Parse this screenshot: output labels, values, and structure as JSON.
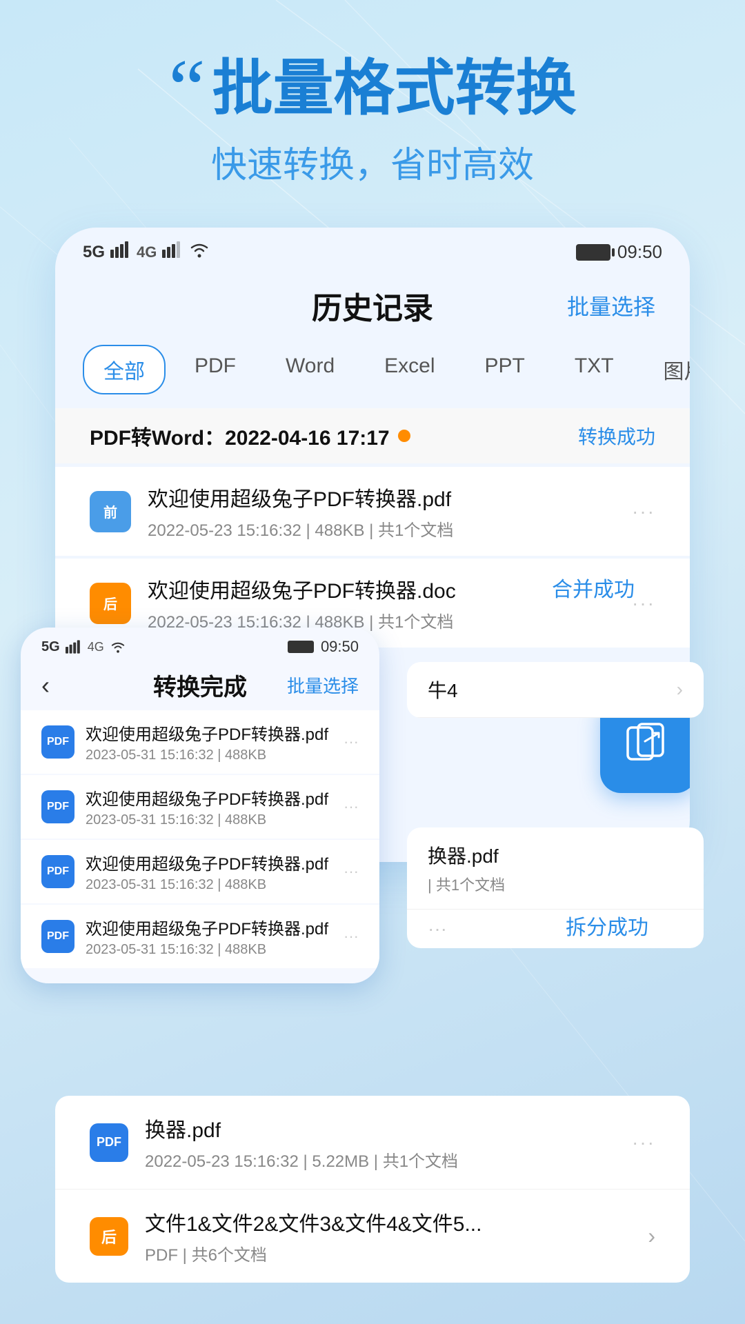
{
  "background": {
    "color_top": "#c5e4f5",
    "color_bottom": "#b0d0ec"
  },
  "header": {
    "quote_mark": "“",
    "title": "批量格式转换",
    "subtitle": "快速转换，省时高效"
  },
  "main_phone": {
    "status_bar": {
      "signal": "5G",
      "signal2": "4G",
      "wifi": "WiFi",
      "battery": "■",
      "time": "09:50"
    },
    "title": "历史记录",
    "batch_btn": "批量选择",
    "tabs": [
      {
        "label": "全部",
        "active": true
      },
      {
        "label": "PDF"
      },
      {
        "label": "Word"
      },
      {
        "label": "Excel"
      },
      {
        "label": "PPT"
      },
      {
        "label": "TXT"
      },
      {
        "label": "图片"
      }
    ],
    "section": {
      "title": "PDF转Word：2022-04-16  17:17",
      "has_dot": true,
      "status": "转换成功"
    },
    "files": [
      {
        "badge_text": "前",
        "badge_type": "qian",
        "name": "欢迎使用超级兔子PDF转换器.pdf",
        "meta": "2022-05-23  15:16:32  |  488KB  |  共1个文档"
      },
      {
        "badge_text": "后",
        "badge_type": "hou",
        "name": "欢迎使用超级兔子PDF转换器.doc",
        "meta": "2022-05-23  15:16:32  |  488KB  |  共1个文档"
      }
    ]
  },
  "secondary_phone": {
    "status_bar": {
      "time": "09:50"
    },
    "title": "转换完成",
    "batch_btn": "批量选择",
    "files": [
      {
        "name": "欢迎使用超级兔子PDF转换器.pdf",
        "meta": "2023-05-31  15:16:32  |  488KB"
      },
      {
        "name": "欢迎使用超级兔子PDF转换器.pdf",
        "meta": "2023-05-31  15:16:32  |  488KB"
      },
      {
        "name": "欢迎使用超级兔子PDF转换器.pdf",
        "meta": "2023-05-31  15:16:32  |  488KB"
      },
      {
        "name": "欢迎使用超级兔子PDF转换器.pdf",
        "meta": "2023-05-31  15:16:32  |  488KB"
      }
    ]
  },
  "merge_success": "合并成功",
  "split_success": "拆分成功",
  "merge_card": {
    "item": {
      "partial_text": "牛4",
      "has_chevron": true
    }
  },
  "split_card": {
    "item1": {
      "name": "换器.pdf",
      "meta": "  |  共1个文档"
    }
  },
  "bottom_section": {
    "file1": {
      "name": "换器.pdf",
      "meta": "2022-05-23  15:16:32  |  5.22MB  |  共1个文档"
    },
    "file2": {
      "badge_text": "后",
      "name": "文件1&文件2&文件3&文件4&文件5...",
      "meta": "PDF  |  共6个文档"
    }
  }
}
